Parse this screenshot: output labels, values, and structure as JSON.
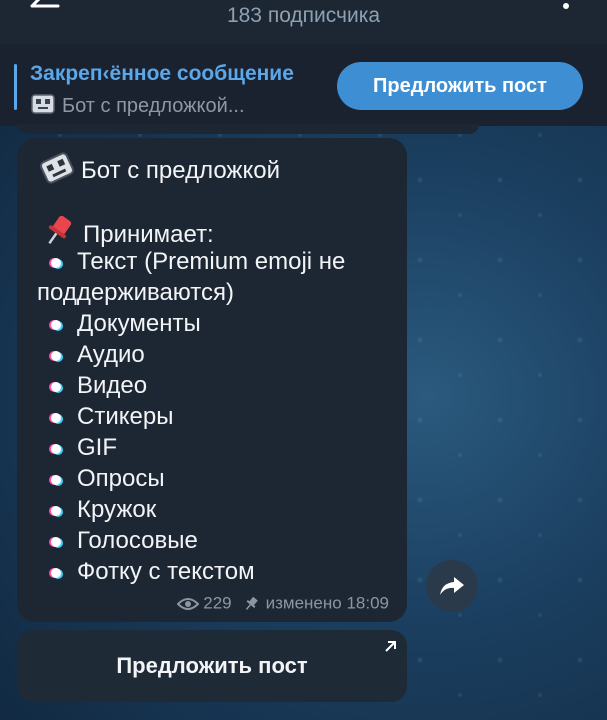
{
  "header": {
    "subtitle": "183 подписчика",
    "back_icon": "arrow-back-icon",
    "more_icon": "more-vertical-icon"
  },
  "pinned": {
    "title": "Закреп‹ённое сообщение",
    "preview": "Бот с предложкой...",
    "suggest_button": "Предложить пост"
  },
  "message": {
    "heading": "Бот с предложкой",
    "accepts": "Принимает:",
    "items": [
      "Текст (Premium emoji не",
      "Документы",
      "Аудио",
      "Видео",
      "Стикеры",
      "GIF",
      "Опросы",
      "Кружок",
      "Голосовые",
      "Фотку с текстом"
    ],
    "item0_cont": "поддерживаются)",
    "views": "229",
    "edited": "изменено 18:09"
  },
  "inline_button": {
    "label": "Предложить пост"
  },
  "colors": {
    "accent": "#3d8ed2",
    "link": "#5ca7e8",
    "bubble": "#1d2734"
  }
}
